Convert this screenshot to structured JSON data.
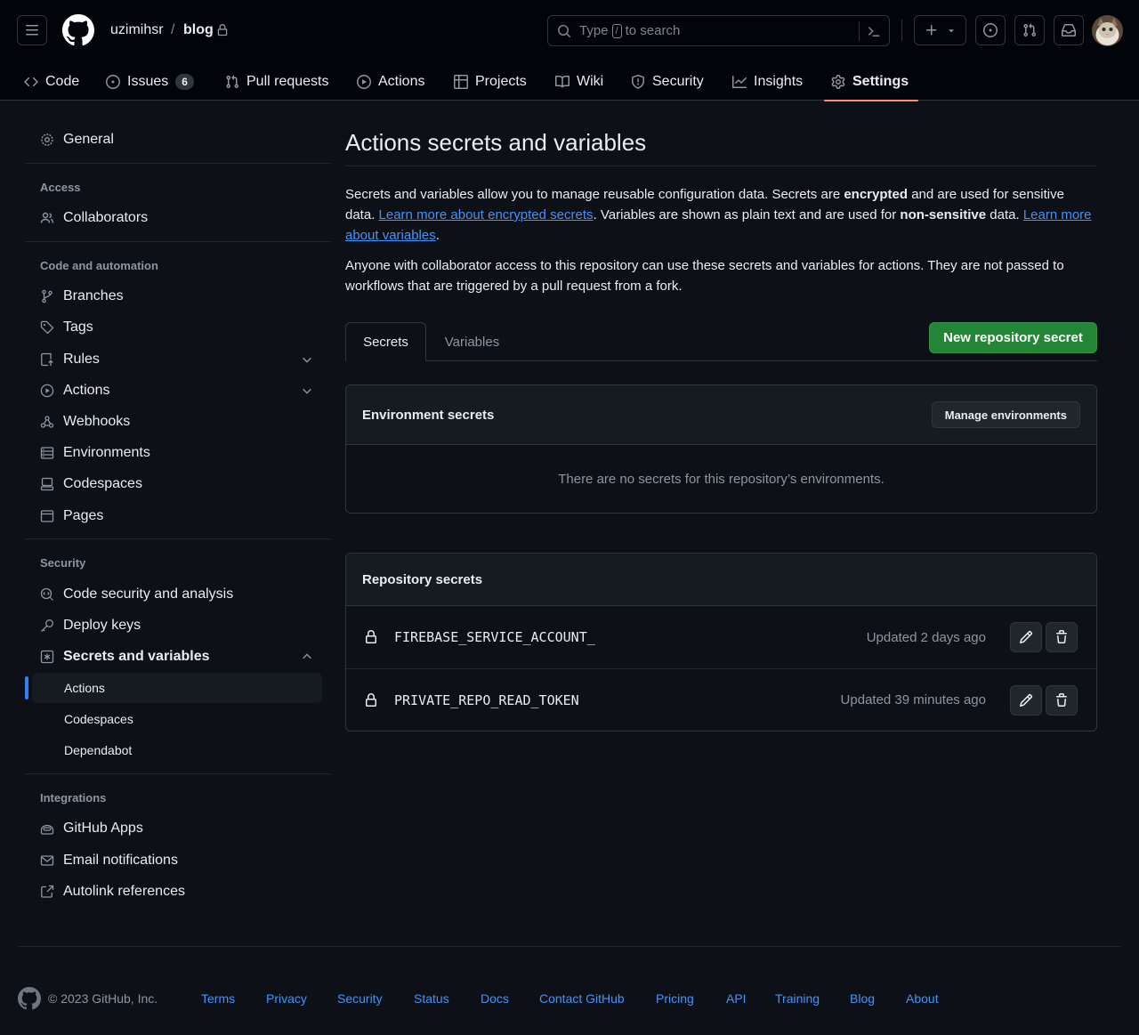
{
  "header": {
    "owner": "uzimihsr",
    "separator": "/",
    "repo": "blog",
    "search_type": "Type",
    "search_key": "/",
    "search_rest": "to search"
  },
  "repo_nav": [
    {
      "label": "Code",
      "icon": "code-icon"
    },
    {
      "label": "Issues",
      "icon": "issue-opened-icon",
      "count": "6"
    },
    {
      "label": "Pull requests",
      "icon": "git-pull-request-icon"
    },
    {
      "label": "Actions",
      "icon": "play-icon"
    },
    {
      "label": "Projects",
      "icon": "table-icon"
    },
    {
      "label": "Wiki",
      "icon": "book-icon"
    },
    {
      "label": "Security",
      "icon": "shield-icon"
    },
    {
      "label": "Insights",
      "icon": "graph-icon"
    },
    {
      "label": "Settings",
      "icon": "gear-icon",
      "selected": true
    }
  ],
  "sidebar": {
    "general": "General",
    "access_heading": "Access",
    "collaborators": "Collaborators",
    "code_heading": "Code and automation",
    "branches": "Branches",
    "tags": "Tags",
    "rules": "Rules",
    "actions": "Actions",
    "webhooks": "Webhooks",
    "environments": "Environments",
    "codespaces": "Codespaces",
    "pages": "Pages",
    "security_heading": "Security",
    "code_security": "Code security and analysis",
    "deploy_keys": "Deploy keys",
    "secrets_variables": "Secrets and variables",
    "sub_actions": "Actions",
    "sub_codespaces": "Codespaces",
    "sub_dependabot": "Dependabot",
    "integrations_heading": "Integrations",
    "github_apps": "GitHub Apps",
    "email_notifications": "Email notifications",
    "autolink_references": "Autolink references"
  },
  "main": {
    "title": "Actions secrets and variables",
    "p1_a": "Secrets and variables allow you to manage reusable configuration data. Secrets are ",
    "p1_b": "encrypted",
    "p1_c": " and are used for sensitive data. ",
    "p1_link1": "Learn more about encrypted secrets",
    "p1_d": ". Variables are shown as plain text and are used for ",
    "p1_e": "non-sensitive",
    "p1_f": " data. ",
    "p1_link2": "Learn more about variables",
    "p1_g": ".",
    "p2": "Anyone with collaborator access to this repository can use these secrets and variables for actions. They are not passed to workflows that are triggered by a pull request from a fork.",
    "tab_secrets": "Secrets",
    "tab_variables": "Variables",
    "new_secret_button": "New repository secret",
    "env_heading": "Environment secrets",
    "manage_env_button": "Manage environments",
    "env_empty": "There are no secrets for this repository’s environments.",
    "repo_heading": "Repository secrets",
    "secrets": [
      {
        "name": "FIREBASE_SERVICE_ACCOUNT_",
        "updated": "Updated 2 days ago"
      },
      {
        "name": "PRIVATE_REPO_READ_TOKEN",
        "updated": "Updated 39 minutes ago"
      }
    ]
  },
  "footer": {
    "copyright": "© 2023 GitHub, Inc.",
    "links": [
      "Terms",
      "Privacy",
      "Security",
      "Status",
      "Docs",
      "Contact GitHub",
      "Pricing",
      "API",
      "Training",
      "Blog",
      "About"
    ]
  },
  "colors": {
    "background": "#0d1117",
    "header": "#010409",
    "accent_link": "#4493f8",
    "primary_button": "#238636",
    "selected_tab_underline": "#fd8c73",
    "active_sidebar_bar": "#2f81f7"
  }
}
